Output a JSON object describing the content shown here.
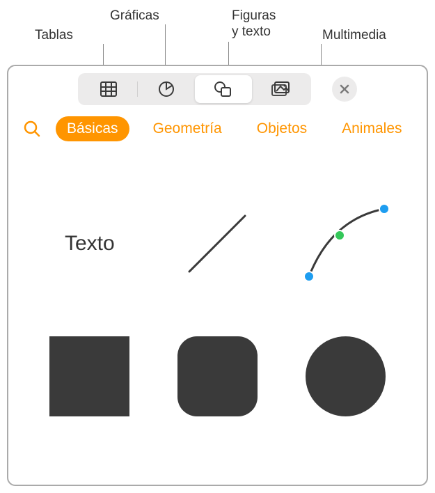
{
  "callouts": {
    "tables": "Tablas",
    "charts": "Gráficas",
    "shapes_text_line1": "Figuras",
    "shapes_text_line2": "y texto",
    "media": "Multimedia"
  },
  "toolbar": {
    "items": [
      {
        "name": "tables-icon"
      },
      {
        "name": "charts-icon"
      },
      {
        "name": "shapes-icon"
      },
      {
        "name": "media-icon"
      }
    ],
    "active_index": 2
  },
  "categories": {
    "items": [
      "Básicas",
      "Geometría",
      "Objetos",
      "Animales"
    ],
    "active_index": 0
  },
  "shapes": {
    "text_label": "Texto"
  },
  "colors": {
    "accent": "#FF9500",
    "shape_dark": "#3a3a3a",
    "handle_blue": "#1E9DF0",
    "handle_green": "#34C759"
  }
}
